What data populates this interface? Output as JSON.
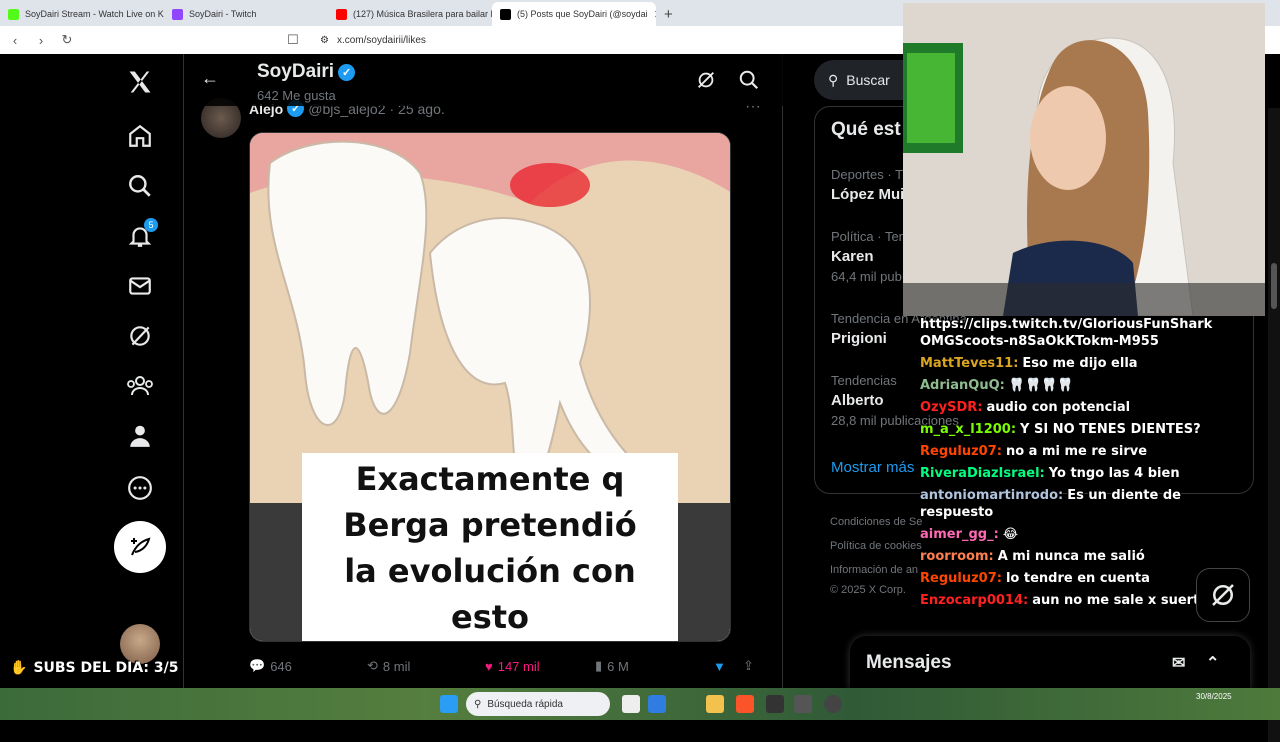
{
  "browser": {
    "tabs": [
      {
        "title": "SoyDairi Stream - Watch Live on Kick",
        "color": "#53fc18",
        "active": false
      },
      {
        "title": "SoyDairi - Twitch",
        "color": "#9146ff",
        "active": false
      },
      {
        "title": "(127) Música Brasilera para bailar M",
        "color": "#ff0000",
        "active": false
      },
      {
        "title": "(5) Posts que SoyDairi (@soydai",
        "color": "#000000",
        "active": true
      }
    ],
    "url": "x.com/soydairii/likes"
  },
  "nav": {
    "notifications_badge": "5"
  },
  "profile": {
    "name": "SoyDairi",
    "likes_count": "642 Me gusta"
  },
  "tweet": {
    "author": "Alejo",
    "handle": "@bjs_alejo2",
    "date": "· 25 ago.",
    "caption_lines": [
      "Exactamente q",
      "Berga pretendió",
      "la evolución con",
      "esto"
    ],
    "replies": "646",
    "reposts": "8 mil",
    "likes": "147 mil",
    "views": "6 M"
  },
  "sidebar": {
    "search_placeholder": "Buscar",
    "trends_title": "Qué est",
    "trends": [
      {
        "category": "Deportes · Tr",
        "name": "López Mui",
        "posts": ""
      },
      {
        "category": "Política · Ten",
        "name": "Karen",
        "posts": "64,4 mil pub"
      },
      {
        "category": "Tendencia en Argentina",
        "name": "Prigioni",
        "posts": ""
      },
      {
        "category": "Tendencias",
        "name": "Alberto",
        "posts": "28,8 mil publicaciones"
      }
    ],
    "show_more": "Mostrar más",
    "footer": [
      "Condiciones de Se",
      "Política de cookies",
      "Información de an",
      "© 2025 X Corp."
    ]
  },
  "overlay": {
    "subs_label": "SUBS DEL DIA: 3/5",
    "chat": [
      {
        "user": "",
        "text": "https://clips.twitch.tv/GloriousFunShark OMGScoots-n8SaOkKTokm-M955",
        "color": "#ffffff"
      },
      {
        "user": "MattTeves11:",
        "text": "Eso me dijo ella",
        "color": "#daa520"
      },
      {
        "user": "AdrianQuQ:",
        "text": "🦷🦷🦷🦷",
        "color": "#8fbc8f"
      },
      {
        "user": "OzySDR:",
        "text": "audio con potencial",
        "color": "#ff2020"
      },
      {
        "user": "m_a_x_l1200:",
        "text": "Y SI NO TENES DIENTES?",
        "color": "#7cfc00"
      },
      {
        "user": "Reguluz07:",
        "text": "no a mi me re sirve",
        "color": "#ff4500"
      },
      {
        "user": "RiveraDiazIsrael:",
        "text": "Yo tngo las 4 bien",
        "color": "#00ff7f"
      },
      {
        "user": "antoniomartinrodo:",
        "text": "Es un diente de respuesto",
        "color": "#b0c4de"
      },
      {
        "user": "aimer_gg_:",
        "text": "😂",
        "color": "#ff69b4"
      },
      {
        "user": "roorroom:",
        "text": "A mi nunca me salió",
        "color": "#ff7f50"
      },
      {
        "user": "Reguluz07:",
        "text": "lo tendre en cuenta",
        "color": "#ff4500"
      },
      {
        "user": "Enzocarp0014:",
        "text": "aun no me sale x suerte",
        "color": "#ff2020"
      }
    ]
  },
  "messages": {
    "title": "Mensajes"
  },
  "taskbar": {
    "search": "Búsqueda rápida",
    "date": "30/8/2025"
  }
}
